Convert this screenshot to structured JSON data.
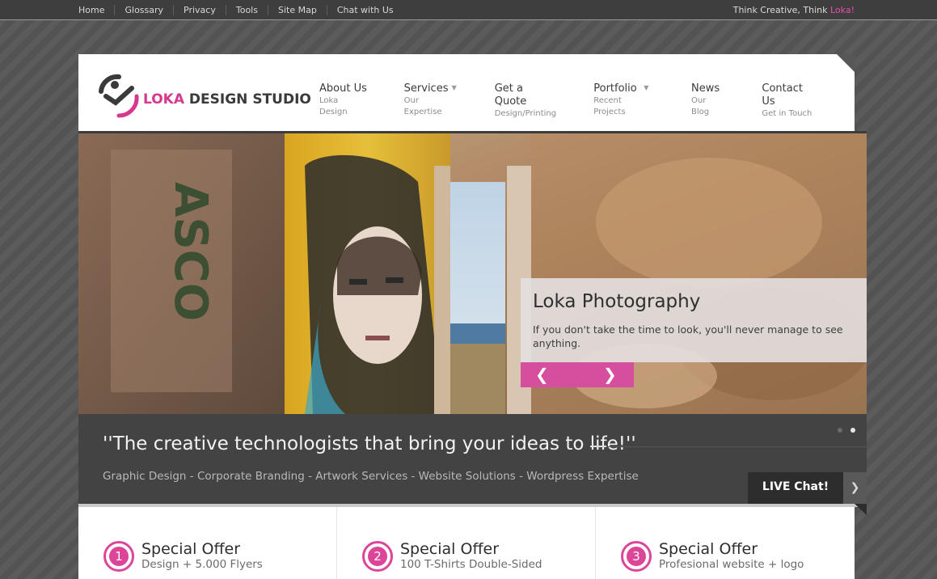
{
  "topbar": {
    "links": [
      "Home",
      "Glossary",
      "Privacy",
      "Tools",
      "Site Map",
      "Chat with Us"
    ],
    "tagline_prefix": "Think Creative, Think ",
    "tagline_brand": "Loka!"
  },
  "brand": {
    "name_accent": "LOKA",
    "name_rest": " DESIGN STUDIO"
  },
  "nav": [
    {
      "title": "About Us",
      "sub": "Loka Design",
      "dropdown": false
    },
    {
      "title": "Services",
      "sub": "Our Expertise",
      "dropdown": true
    },
    {
      "title": "Get a Quote",
      "sub": "Design/Printing",
      "dropdown": false
    },
    {
      "title": "Portfolio",
      "sub": "Recent Projects",
      "dropdown": true
    },
    {
      "title": "News",
      "sub": "Our Blog",
      "dropdown": false
    },
    {
      "title": "Contact Us",
      "sub": "Get in Touch",
      "dropdown": false
    }
  ],
  "slider": {
    "caption_title": "Loka Photography",
    "caption_text": "If you don't take the time to look, you'll never manage to see anything.",
    "prev_icon": "chevron-left-icon",
    "next_icon": "chevron-right-icon",
    "graffiti_text": "ASCO"
  },
  "band": {
    "quote": "''The creative technologists that bring your ideas to life!''",
    "services": "Graphic Design - Corporate Branding - Artwork Services - Website Solutions - Wordpress Expertise",
    "live_chat": "LIVE Chat!"
  },
  "offers": [
    {
      "number": "1",
      "title": "Special Offer",
      "subtitle": "Design + 5.000 Flyers"
    },
    {
      "number": "2",
      "title": "Special Offer",
      "subtitle": "100 T-Shirts Double-Sided"
    },
    {
      "number": "3",
      "title": "Special Offer",
      "subtitle": "Profesional website + logo"
    }
  ],
  "colors": {
    "accent": "#d54f9e",
    "background": "#575757"
  }
}
